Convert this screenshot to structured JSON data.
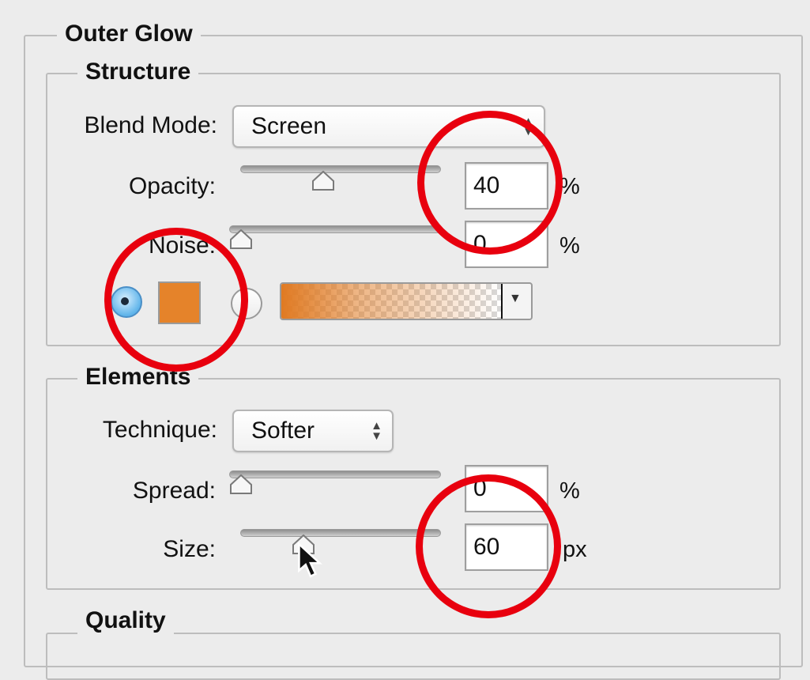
{
  "panel": {
    "title": "Outer Glow",
    "structure": {
      "title": "Structure",
      "blend_mode": {
        "label": "Blend Mode:",
        "value": "Screen"
      },
      "opacity": {
        "label": "Opacity:",
        "value": "40",
        "unit": "%",
        "slider_fraction": 0.4
      },
      "noise": {
        "label": "Noise:",
        "value": "0",
        "unit": "%",
        "slider_fraction": 0.0
      },
      "color_mode": "solid-color",
      "glow_color": "#e5832a",
      "gradient_from_color": "#e07a22"
    },
    "elements": {
      "title": "Elements",
      "technique": {
        "label": "Technique:",
        "value": "Softer"
      },
      "spread": {
        "label": "Spread:",
        "value": "0",
        "unit": "%",
        "slider_fraction": 0.0
      },
      "size": {
        "label": "Size:",
        "value": "60",
        "unit": "px",
        "slider_fraction": 0.29
      }
    },
    "quality": {
      "title": "Quality"
    }
  },
  "annotations": {
    "highlight_color": "#e8000e"
  }
}
